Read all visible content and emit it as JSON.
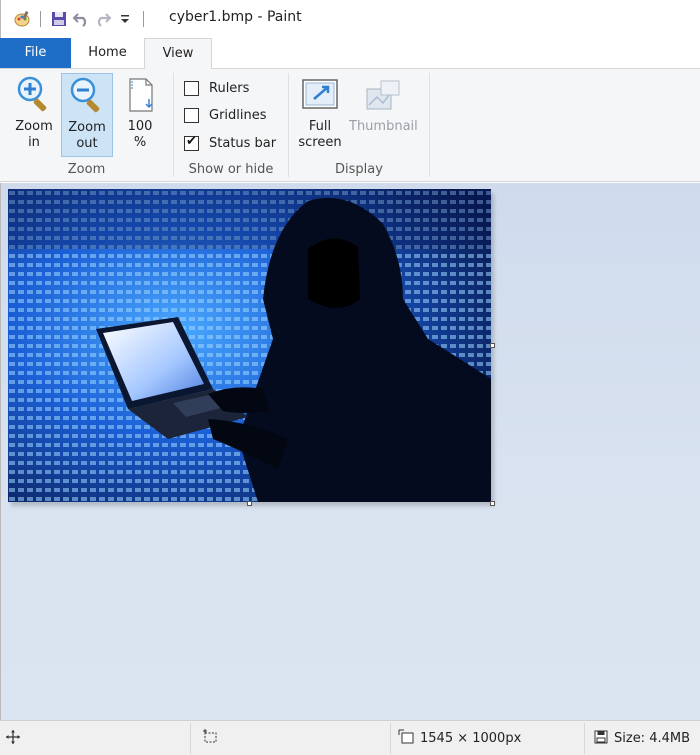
{
  "window": {
    "title": "cyber1.bmp - Paint"
  },
  "qat": {
    "icons": [
      "paint-app-icon",
      "save-icon",
      "undo-icon",
      "redo-icon",
      "customize-dropdown-icon"
    ]
  },
  "tabs": [
    {
      "label": "File"
    },
    {
      "label": "Home"
    },
    {
      "label": "View"
    }
  ],
  "ribbon": {
    "zoom_group": {
      "label": "Zoom",
      "zoom_in": "Zoom\nin",
      "zoom_out": "Zoom\nout",
      "hundred": "100\n%"
    },
    "show_hide_group": {
      "label": "Show or hide",
      "rulers": {
        "label": "Rulers",
        "checked": false
      },
      "gridlines": {
        "label": "Gridlines",
        "checked": false
      },
      "statusbar": {
        "label": "Status bar",
        "checked": true
      }
    },
    "display_group": {
      "label": "Display",
      "fullscreen": "Full\nscreen",
      "thumbnail": "Thumbnail"
    }
  },
  "canvas": {
    "image_description_icon": "hooded-hacker-laptop-image"
  },
  "statusbar": {
    "dimensions": "1545 × 1000px",
    "size": "Size: 4.4MB"
  },
  "colors": {
    "file_tab": "#1e6ec8",
    "ribbon_bg": "#f5f6f7",
    "workspace_bg": "#d3deee",
    "pressed_bg": "#cde4f7"
  }
}
